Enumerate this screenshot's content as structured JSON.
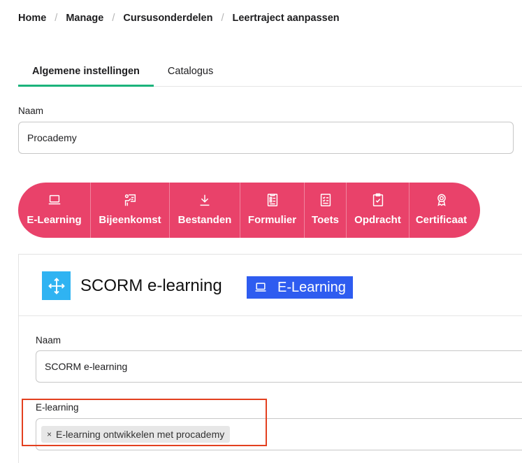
{
  "breadcrumb": {
    "items": [
      "Home",
      "Manage",
      "Cursusonderdelen",
      "Leertraject aanpassen"
    ],
    "separator": "/"
  },
  "tabs": [
    {
      "label": "Algemene instellingen",
      "active": true
    },
    {
      "label": "Catalogus",
      "active": false
    }
  ],
  "form": {
    "name_label": "Naam",
    "name_value": "Procademy"
  },
  "toolbar": {
    "color": "#e9426a",
    "items": [
      {
        "label": "E-Learning",
        "icon": "laptop-icon"
      },
      {
        "label": "Bijeenkomst",
        "icon": "presentation-icon"
      },
      {
        "label": "Bestanden",
        "icon": "download-icon"
      },
      {
        "label": "Formulier",
        "icon": "form-icon"
      },
      {
        "label": "Toets",
        "icon": "checklist-icon"
      },
      {
        "label": "Opdracht",
        "icon": "clipboard-check-icon"
      },
      {
        "label": "Certificaat",
        "icon": "award-icon"
      }
    ]
  },
  "card": {
    "title": "SCORM e-learning",
    "badge_label": "E-Learning",
    "badge_color": "#2e5cf0",
    "move_icon_color": "#2fb3f2",
    "name_label": "Naam",
    "name_value": "SCORM e-learning",
    "elearning_label": "E-learning",
    "tag_remove": "×",
    "selected_tag": "E-learning ontwikkelen met procademy"
  }
}
